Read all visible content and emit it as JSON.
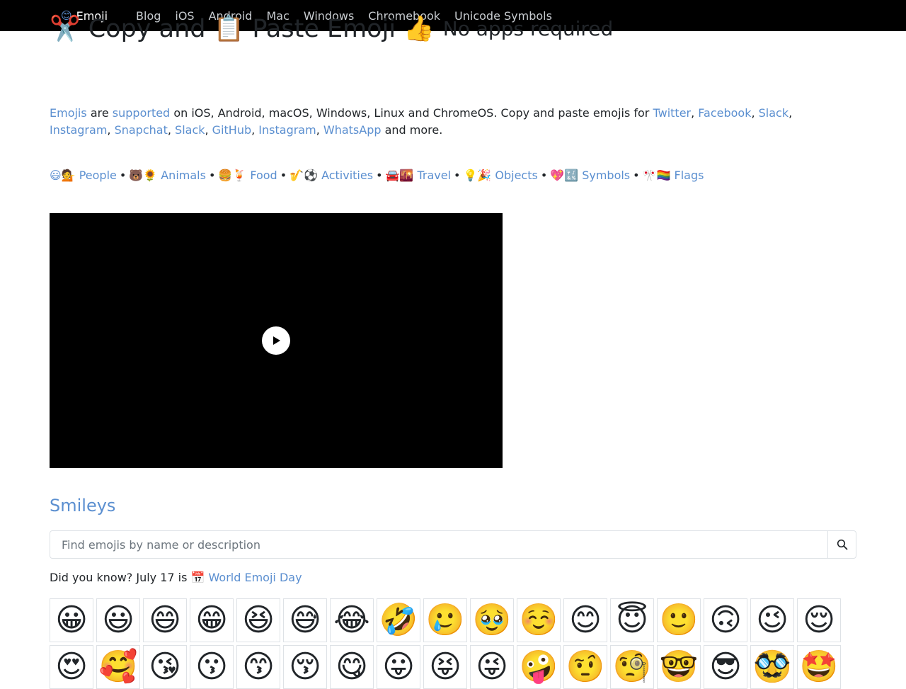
{
  "nav": {
    "brand_icon": "😊",
    "brand": "Emoji",
    "items": [
      "Blog",
      "iOS",
      "Android",
      "Mac",
      "Windows",
      "Chromebook",
      "Unicode Symbols"
    ]
  },
  "title": {
    "scissors": "✂️",
    "copy_and": "Copy and",
    "clipboard": "📋",
    "paste_emoji": "Paste Emoji",
    "thumbs": "👍",
    "subtitle": "No apps required"
  },
  "intro": {
    "emojis": "Emojis",
    "are": "are",
    "supported": "supported",
    "text1": "on iOS, Android, macOS, Windows, Linux and ChromeOS. Copy and paste emojis for",
    "links": [
      "Twitter",
      "Facebook",
      "Slack",
      "Instagram",
      "Snapchat",
      "Slack",
      "GitHub",
      "Instagram",
      "WhatsApp"
    ],
    "text_end": "and more."
  },
  "categories": [
    {
      "icons": "😃💁",
      "label": "People"
    },
    {
      "icons": "🐻🌻",
      "label": "Animals"
    },
    {
      "icons": "🍔🍹",
      "label": "Food"
    },
    {
      "icons": "🎷⚽",
      "label": "Activities"
    },
    {
      "icons": "🚘🌇",
      "label": "Travel"
    },
    {
      "icons": "💡🎉",
      "label": "Objects"
    },
    {
      "icons": "💖🔣",
      "label": "Symbols"
    },
    {
      "icons": "🎌🏳️‍🌈",
      "label": "Flags"
    }
  ],
  "category_separator": "•",
  "section_title": "Smileys",
  "search": {
    "placeholder": "Find emojis by name or description",
    "icon": "search-icon"
  },
  "did_you_know": {
    "text": "Did you know? July 17 is",
    "icon": "📅",
    "link": "World Emoji Day"
  },
  "emojis": [
    "😀",
    "😃",
    "😄",
    "😁",
    "😆",
    "😅",
    "😂",
    "🤣",
    "🥲",
    "🥹",
    "☺️",
    "😊",
    "😇",
    "🙂",
    "🙃",
    "😉",
    "😌",
    "😍",
    "🥰",
    "😘",
    "😗",
    "😙",
    "😚",
    "😋",
    "😛",
    "😝",
    "😜",
    "🤪",
    "🤨",
    "🧐",
    "🤓",
    "😎",
    "🥸",
    "🤩"
  ]
}
